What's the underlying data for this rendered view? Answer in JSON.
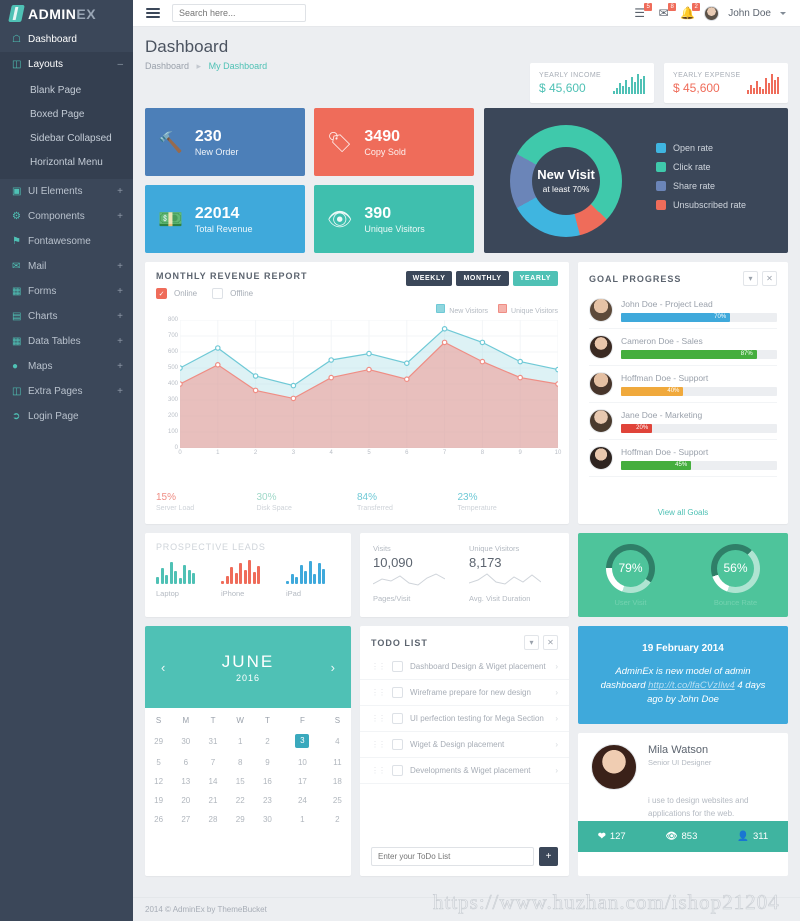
{
  "brand": {
    "name_strong": "ADMIN",
    "name_light": "EX"
  },
  "sidebar": {
    "items": [
      {
        "label": "Dashboard",
        "icon": "home-icon",
        "expand": ""
      },
      {
        "label": "Layouts",
        "icon": "layout-icon",
        "expand": "–"
      },
      {
        "label": "UI Elements",
        "icon": "ui-icon",
        "expand": "+"
      },
      {
        "label": "Components",
        "icon": "components-icon",
        "expand": "+"
      },
      {
        "label": "Fontawesome",
        "icon": "flag-icon",
        "expand": ""
      },
      {
        "label": "Mail",
        "icon": "mail-icon",
        "expand": "+"
      },
      {
        "label": "Forms",
        "icon": "forms-icon",
        "expand": "+"
      },
      {
        "label": "Charts",
        "icon": "charts-icon",
        "expand": "+"
      },
      {
        "label": "Data Tables",
        "icon": "table-icon",
        "expand": "+"
      },
      {
        "label": "Maps",
        "icon": "map-pin-icon",
        "expand": "+"
      },
      {
        "label": "Extra Pages",
        "icon": "pages-icon",
        "expand": "+"
      },
      {
        "label": "Login Page",
        "icon": "login-icon",
        "expand": ""
      }
    ],
    "layouts_sub": [
      "Blank Page",
      "Boxed Page",
      "Sidebar Collapsed",
      "Horizontal Menu"
    ]
  },
  "topbar": {
    "search_placeholder": "Search here...",
    "notifications": [
      {
        "icon": "tasks-icon",
        "badge": "5"
      },
      {
        "icon": "envelope-icon",
        "badge": "8"
      },
      {
        "icon": "bell-icon",
        "badge": "2"
      }
    ],
    "user": "John Doe"
  },
  "page": {
    "title": "Dashboard",
    "breadcrumb_root": "Dashboard",
    "breadcrumb_current": "My Dashboard"
  },
  "mini_cards": [
    {
      "label": "YEARLY INCOME",
      "value": "$ 45,600",
      "color": "#4fc1b5",
      "tone": "green"
    },
    {
      "label": "YEARLY EXPENSE",
      "value": "$ 45,600",
      "color": "#ef6c5a",
      "tone": "red"
    }
  ],
  "tiles": [
    {
      "number": "230",
      "label": "New Order",
      "icon": "gavel-icon",
      "bg": "#4c7fb8"
    },
    {
      "number": "3490",
      "label": "Copy Sold",
      "icon": "tag-icon",
      "bg": "#ef6c5a"
    },
    {
      "number": "22014",
      "label": "Total Revenue",
      "icon": "money-icon",
      "bg": "#3fa9db"
    },
    {
      "number": "390",
      "label": "Unique Visitors",
      "icon": "eye-icon",
      "bg": "#3fbfae"
    }
  ],
  "donut": {
    "title": "New Visit",
    "subtitle": "at least 70%",
    "legend": [
      {
        "label": "Open rate",
        "color": "#3fb5e0"
      },
      {
        "label": "Click rate",
        "color": "#3fc9ab"
      },
      {
        "label": "Share rate",
        "color": "#6b85b8"
      },
      {
        "label": "Unsubscribed rate",
        "color": "#ef6c5a"
      }
    ]
  },
  "revenue": {
    "title": "MONTHLY REVENUE REPORT",
    "check_online": "Online",
    "check_offline": "Offline",
    "ranges": [
      "WEEKLY",
      "MONTHLY",
      "YEARLY"
    ],
    "active_range": "YEARLY",
    "legend": [
      {
        "label": "New Visitors",
        "color": "#6fc9d6"
      },
      {
        "label": "Unique Visitors",
        "color": "#ef8d84"
      }
    ],
    "stats": [
      {
        "value": "15%",
        "label": "Server Load",
        "color": "#ef8d84"
      },
      {
        "value": "30%",
        "label": "Disk Space",
        "color": "#9fd8c8"
      },
      {
        "value": "84%",
        "label": "Transferred",
        "color": "#6fc9d6"
      },
      {
        "value": "23%",
        "label": "Temperature",
        "color": "#6fc9d6"
      }
    ]
  },
  "chart_data": {
    "type": "area",
    "title": "MONTHLY REVENUE REPORT",
    "xlabel": "",
    "ylabel": "",
    "x": [
      0,
      1,
      2,
      3,
      4,
      5,
      6,
      7,
      8,
      9,
      10
    ],
    "ylim": [
      0,
      800
    ],
    "xlim": [
      0,
      10
    ],
    "yticks": [
      0,
      100,
      200,
      300,
      400,
      500,
      600,
      700,
      800
    ],
    "grid": true,
    "legend_position": "top-right",
    "series": [
      {
        "name": "New Visitors",
        "color": "#6fc9d6",
        "values": [
          500,
          625,
          450,
          390,
          550,
          590,
          530,
          745,
          660,
          540,
          490
        ]
      },
      {
        "name": "Unique Visitors",
        "color": "#ef8d84",
        "values": [
          400,
          520,
          360,
          310,
          440,
          490,
          430,
          660,
          540,
          440,
          400
        ]
      }
    ]
  },
  "goals": {
    "title": "GOAL PROGRESS",
    "view_all": "View all Goals",
    "items": [
      {
        "name": "John Doe - Project Lead",
        "percent": "70%",
        "value": 70,
        "color": "#3fa9db"
      },
      {
        "name": "Cameron Doe - Sales",
        "percent": "87%",
        "value": 87,
        "color": "#45ae3e"
      },
      {
        "name": "Hoffman Doe - Support",
        "percent": "40%",
        "value": 40,
        "color": "#f0a93c"
      },
      {
        "name": "Jane Doe - Marketing",
        "percent": "20%",
        "value": 20,
        "color": "#e0443a"
      },
      {
        "name": "Hoffman Doe - Support",
        "percent": "45%",
        "value": 45,
        "color": "#45ae3e"
      }
    ]
  },
  "prospective": {
    "title_strong": "PROSPECTIVE",
    "title_light": "LEADS",
    "items": [
      {
        "label": "Laptop",
        "color": "#4fc1b5",
        "bars": [
          7,
          16,
          9,
          22,
          13,
          6,
          19,
          14,
          11
        ]
      },
      {
        "label": "iPhone",
        "color": "#ef6c5a",
        "bars": [
          3,
          8,
          17,
          11,
          21,
          14,
          24,
          12,
          18
        ]
      },
      {
        "label": "iPad",
        "color": "#3fa9db",
        "bars": [
          3,
          10,
          7,
          19,
          13,
          23,
          10,
          21,
          15
        ]
      }
    ]
  },
  "visits": [
    {
      "label": "Visits",
      "value": "10,090",
      "footer": "Pages/Visit"
    },
    {
      "label": "Unique Visitors",
      "value": "8,173",
      "footer": "Avg. Visit Duration"
    }
  ],
  "circles": [
    {
      "percent": "79%",
      "value": 79,
      "label": "User Visit"
    },
    {
      "percent": "56%",
      "value": 56,
      "label": "Bounce Rate"
    }
  ],
  "calendar": {
    "month": "JUNE",
    "year": "2016",
    "prev": "‹",
    "next": "›",
    "weekdays": [
      "S",
      "M",
      "T",
      "W",
      "T",
      "F",
      "S"
    ],
    "weeks": [
      [
        "29",
        "30",
        "31",
        "1",
        "2",
        "3",
        "4"
      ],
      [
        "5",
        "6",
        "7",
        "8",
        "9",
        "10",
        "11"
      ],
      [
        "12",
        "13",
        "14",
        "15",
        "16",
        "17",
        "18"
      ],
      [
        "19",
        "20",
        "21",
        "22",
        "23",
        "24",
        "25"
      ],
      [
        "26",
        "27",
        "28",
        "29",
        "30",
        "1",
        "2"
      ]
    ],
    "today": "3"
  },
  "todo": {
    "title": "TODO LIST",
    "items": [
      "Dashboard Design & Wiget placement",
      "Wireframe prepare for new design",
      "UI perfection testing for Mega Section",
      "Wiget & Design placement",
      "Developments & Wiget placement"
    ],
    "input_placeholder": "Enter your ToDo List",
    "add_label": "+"
  },
  "announcement": {
    "date": "19 February 2014",
    "text_before": "AdminEx is new model of admin dashboard ",
    "link": "http://t.co/lfaCVzIlw4",
    "text_after": " 4 days ago by John Doe"
  },
  "profile": {
    "name": "Mila Watson",
    "role": "Senior UI Designer",
    "desc": "i use to design websites and applications for the web.",
    "stats": [
      {
        "icon": "heart-icon",
        "value": "127"
      },
      {
        "icon": "eye-icon",
        "value": "853"
      },
      {
        "icon": "user-icon",
        "value": "311"
      }
    ]
  },
  "footer": {
    "text": "2014 © AdminEx by ThemeBucket"
  },
  "watermark": "https://www.huzhan.com/ishop21204"
}
